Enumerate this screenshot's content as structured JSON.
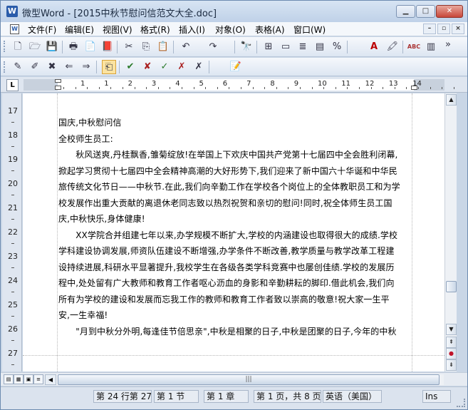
{
  "window": {
    "title": "微型Word - [2015中秋节慰问信范文大全.doc]",
    "app_icon_letter": "W",
    "controls": {
      "minimize": "▁",
      "maximize": "□",
      "close": "✕"
    }
  },
  "menubar": {
    "doc_icon": "W",
    "items": [
      "文件(F)",
      "编辑(E)",
      "视图(V)",
      "格式(R)",
      "插入(I)",
      "对象(O)",
      "表格(A)",
      "窗口(W)"
    ],
    "mdi_controls": [
      "–",
      "▫",
      "×"
    ]
  },
  "toolbar1": {
    "icons": [
      "new-document-icon",
      "open-folder-icon",
      "save-icon",
      "print-icon",
      "print-preview-icon",
      "spellcheck-pdf-icon",
      "cut-icon",
      "copy-icon",
      "paste-icon",
      "undo-icon",
      "redo-icon",
      "find-icon",
      "insert-table-icon",
      "insert-field-icon",
      "page-layout-icon",
      "columns-icon",
      "special-char-icon",
      "text-color-icon",
      "highlight-icon",
      "spelling-abc-icon",
      "chart-icon",
      "overflow-chevron-icon"
    ],
    "glyphs": [
      "🗋",
      "🗁",
      "💾",
      "🖶",
      "📄",
      "📕",
      "✂",
      "⎘",
      "📋",
      "↶",
      "↷",
      "🔭",
      "⊞",
      "▭",
      "≣",
      "▤",
      "%",
      "A",
      "🖍",
      "ABC",
      "▥",
      "»"
    ]
  },
  "toolbar2": {
    "icons": [
      "new-comment-icon",
      "edit-comment-icon",
      "delete-comment-icon",
      "prev-comment-icon",
      "next-comment-icon",
      "track-changes-icon",
      "accept-change-icon",
      "reject-change-icon",
      "accept-all-icon",
      "reject-all-icon",
      "review-pane-icon"
    ],
    "glyphs": [
      "✎",
      "✐",
      "✖",
      "⇐",
      "⇒",
      "⎗",
      "✔",
      "✘",
      "✓",
      "✗",
      "📝"
    ]
  },
  "ruler": {
    "tab_selector": "L",
    "numbers": [
      "1",
      "1",
      "2",
      "3",
      "4",
      "5",
      "6",
      "7",
      "8",
      "9",
      "10",
      "11",
      "12",
      "13",
      "14"
    ],
    "vertical_numbers": [
      "17",
      "18",
      "19",
      "20",
      "21",
      "22",
      "23",
      "24",
      "25",
      "26",
      "27"
    ]
  },
  "document": {
    "paragraphs": [
      "国庆,中秋慰问信",
      "全校师生员工:",
      "　　秋风送爽,丹桂飘香,雏菊绽放!在举国上下欢庆中国共产党第十七届四中全会胜利闭幕,",
      "掀起学习贯彻十七届四中全会精神高潮的大好形势下,我们迎来了新中国六十华诞和中华民",
      "旅传统文化节日——中秋节.在此,我们向辛勤工作在学校各个岗位上的全体教职员工和为学",
      "校发展作出重大贡献的离退休老同志致以热烈祝贺和亲切的慰问!同时,祝全体师生员工国",
      "庆,中秋快乐,身体健康!",
      "　　XX学院合并组建七年以来,办学规模不断扩大,学校的内涵建设也取得很大的成绩.学校",
      "学科建设协调发展,师资队伍建设不断增强,办学条件不断改善,教学质量与教学改革工程建",
      "设持续进展,科研水平显著提升,我校学生在各级各类学科竞赛中也屡创佳绩.学校的发展历",
      "程中,处处留有广大教师和教育工作者呕心沥血的身影和辛勤耕耘的脚印.借此机会,我们向",
      "所有为学校的建设和发展而忘我工作的教师和教育工作者致以崇高的敬意!祝大家一生平",
      "安,一生幸福!",
      "　　\"月到中秋分外明,每逢佳节倍思亲\",中秋是相聚的日子,中秋是团聚的日子,今年的中秋"
    ]
  },
  "vscroll": {
    "up": "▲",
    "down": "▼",
    "prev_page": "⇞",
    "select_browse": "●",
    "next_page": "⇟"
  },
  "hscroll": {
    "left": "◀",
    "right": "▶",
    "thumb_grip": "|||"
  },
  "statusbar": {
    "position": "第 24 行第 27",
    "section": "第 1 节",
    "chapter": "第 1 章",
    "page": "第 1 页，共 8 页",
    "language": "英语（美国）",
    "mode": "Ins"
  },
  "colors": {
    "accent": "#2a5caa",
    "close_button": "#c8473a",
    "chrome": "#dbe3ee"
  }
}
